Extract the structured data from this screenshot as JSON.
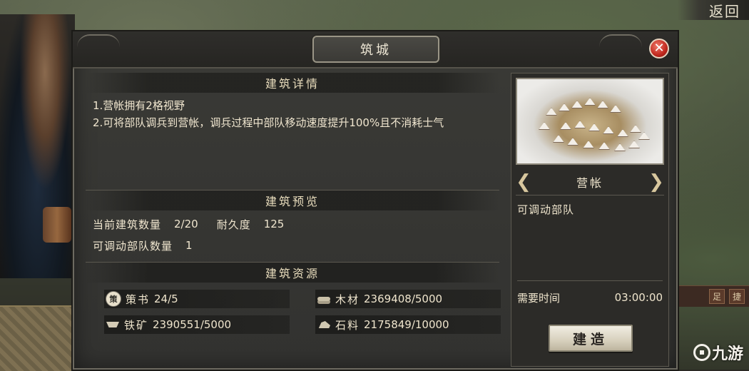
{
  "top_nav": {
    "back_label": "返回"
  },
  "right_strip": {
    "tags": [
      "足",
      "捷"
    ]
  },
  "watermark": {
    "text": "九游"
  },
  "dialog": {
    "title": "筑城",
    "close_icon": "close-x-icon"
  },
  "details": {
    "header": "建筑详情",
    "lines": [
      "1.营帐拥有2格视野",
      "2.可将部队调兵到营帐，调兵过程中部队移动速度提升100%且不消耗士气"
    ]
  },
  "preview": {
    "header": "建筑预览",
    "count_label": "当前建筑数量",
    "count_value": "2/20",
    "durability_label": "耐久度",
    "durability_value": "125",
    "troops_label": "可调动部队数量",
    "troops_value": "1"
  },
  "resources": {
    "header": "建筑资源",
    "items": [
      {
        "icon": "strategy-book-icon",
        "icon_glyph": "策",
        "name": "策书",
        "value": "24/5"
      },
      {
        "icon": "wood-icon",
        "name": "木材",
        "value": "2369408/5000"
      },
      {
        "icon": "iron-icon",
        "name": "铁矿",
        "value": "2390551/5000"
      },
      {
        "icon": "stone-icon",
        "name": "石料",
        "value": "2175849/10000"
      }
    ]
  },
  "building": {
    "name": "营帐",
    "description": "可调动部队",
    "time_label": "需要时间",
    "time_value": "03:00:00",
    "build_label": "建造",
    "prev_icon": "chevron-left-icon",
    "next_icon": "chevron-right-icon"
  }
}
